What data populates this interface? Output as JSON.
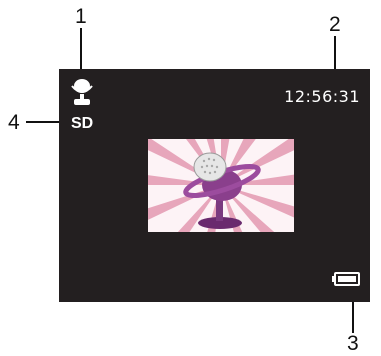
{
  "callouts": {
    "c1": "1",
    "c2": "2",
    "c3": "3",
    "c4": "4"
  },
  "screen": {
    "time": "12:56:31",
    "storage_label": "SD"
  },
  "icons": {
    "mode": "microphone-icon",
    "battery": "battery-icon",
    "center_image": "microphone-illustration"
  },
  "colors": {
    "screen_bg": "#231f20",
    "text": "#ffffff",
    "ray_pink": "#e7a6bb",
    "mic_purple": "#8a3f8c"
  }
}
